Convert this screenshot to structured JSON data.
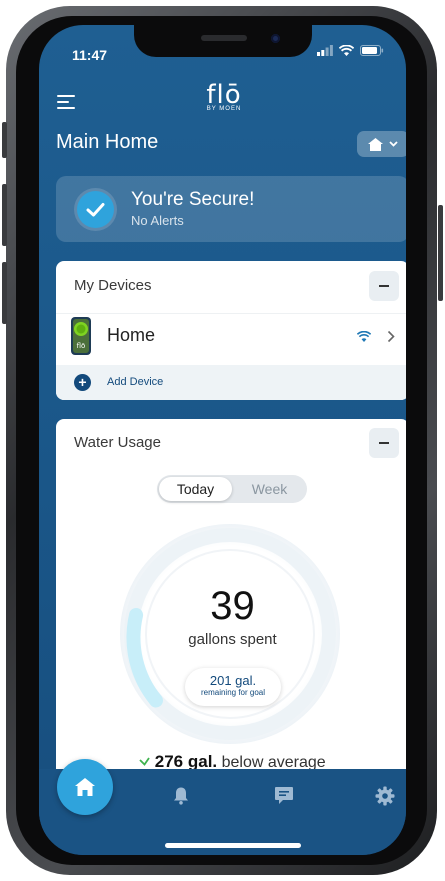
{
  "status_bar": {
    "time": "11:47"
  },
  "header": {
    "logo_main": "flō",
    "logo_sub": "BY MOEN",
    "home_name": "Main Home"
  },
  "security": {
    "title": "You're Secure!",
    "subtitle": "No Alerts"
  },
  "devices_card": {
    "title": "My Devices",
    "devices": [
      {
        "name": "Home",
        "icon": "flo-device-icon"
      }
    ],
    "add_label": "Add Device"
  },
  "water_card": {
    "title": "Water Usage",
    "tabs": [
      "Today",
      "Week"
    ],
    "selected_tab": "Today",
    "gallons": "39",
    "gallons_label": "gallons spent",
    "remaining": "201 gal.",
    "remaining_label": "remaining for goal",
    "comparison_value": "276 gal.",
    "comparison_text": "below average"
  },
  "nav": {
    "items": [
      "home-icon",
      "bell-icon",
      "message-icon",
      "gear-icon"
    ]
  },
  "colors": {
    "accent": "#2fa3dc",
    "background": "#1f5f92",
    "card": "#ffffff"
  }
}
